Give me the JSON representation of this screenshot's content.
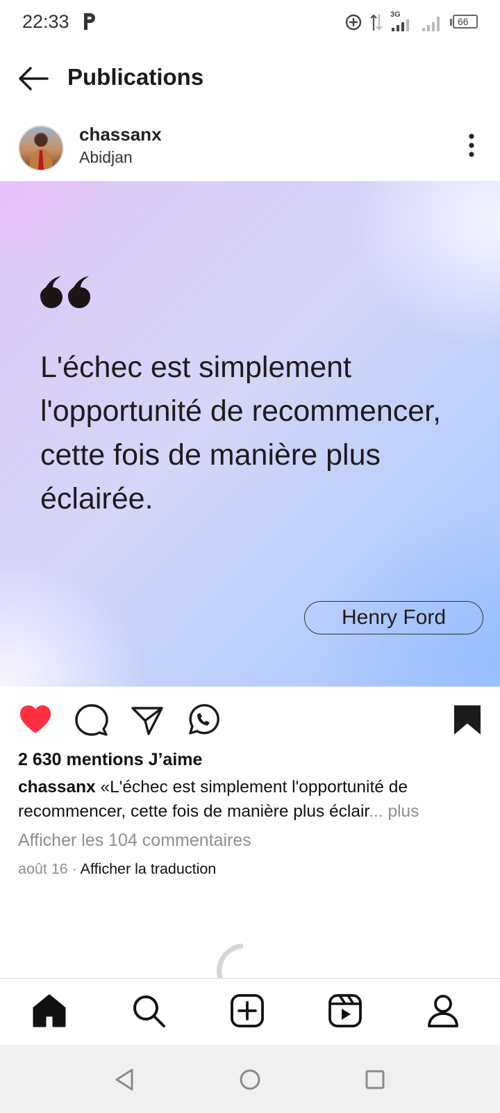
{
  "status_bar": {
    "time": "22:33",
    "network": "3G",
    "battery": "66"
  },
  "header": {
    "title": "Publications"
  },
  "post": {
    "username": "chassanx",
    "location": "Abidjan",
    "image": {
      "quote": "L'échec est simplement l'opportunité de recommencer, cette fois de manière plus éclairée.",
      "author": "Henry Ford"
    },
    "liked": true,
    "saved": true,
    "likes_text": "2 630 mentions J’aime",
    "caption_user": "chassanx",
    "caption_text": "«L'échec est simplement l'opportunité de recommencer, cette fois de manière plus éclair",
    "caption_more": "... plus",
    "view_comments": "Afficher les 104 commentaires",
    "date": "août 16",
    "date_separator": " · ",
    "translate": "Afficher la traduction"
  },
  "colors": {
    "like": "#ff3040",
    "muted": "#8e8e8e"
  },
  "icons": {
    "back": "arrow-left-icon",
    "more": "more-vertical-icon",
    "like": "heart-icon",
    "comment": "comment-icon",
    "share": "send-icon",
    "whatsapp": "whatsapp-icon",
    "save": "bookmark-icon",
    "nav": [
      "home-icon",
      "search-icon",
      "add-post-icon",
      "reels-icon",
      "profile-icon"
    ],
    "system": [
      "back-triangle-icon",
      "home-circle-icon",
      "recents-square-icon"
    ]
  }
}
